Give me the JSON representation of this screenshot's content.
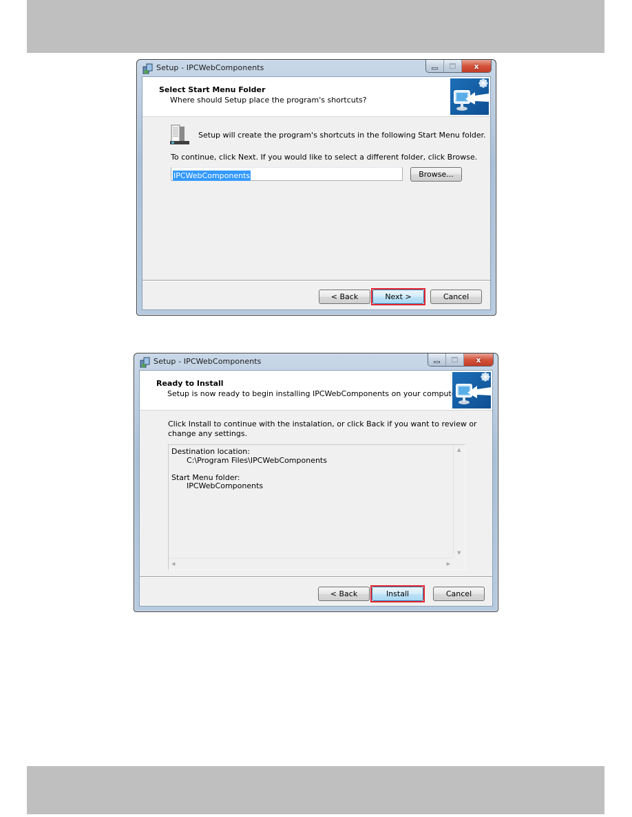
{
  "document": {
    "header_band": "",
    "footer_band": ""
  },
  "window1": {
    "title": "Setup - IPCWebComponents",
    "caption_buttons": {
      "minimize": "minimize",
      "maximize": "maximize",
      "close": "x"
    },
    "header": {
      "title": "Select Start Menu Folder",
      "subtitle": "Where should Setup place the program's shortcuts?",
      "image_icon": "monitor-arrow-icon"
    },
    "body": {
      "icon": "start-menu-folder-icon",
      "info_text": "Setup will create the program's shortcuts in the following Start Menu folder.",
      "instruction_text": "To continue, click Next. If you would like to select a different folder, click Browse.",
      "folder_input_value": "IPCWebComponents",
      "browse_label": "Browse..."
    },
    "footer": {
      "back_label": "< Back",
      "next_label": "Next >",
      "cancel_label": "Cancel",
      "highlighted_button": "Next >"
    }
  },
  "window2": {
    "title": "Setup - IPCWebComponents",
    "caption_buttons": {
      "minimize": "minimize",
      "maximize": "maximize",
      "close": "x"
    },
    "header": {
      "title": "Ready to Install",
      "subtitle": "Setup is now ready to begin installing IPCWebComponents on your computer.",
      "image_icon": "monitor-arrow-icon"
    },
    "body": {
      "instruction_line1": "Click Install to continue with the instalation, or click Back if you want to review or",
      "instruction_line2": "change any settings.",
      "summary": {
        "destination_label": "Destination location:",
        "destination_value": "C:\\Program Files\\IPCWebComponents",
        "start_menu_label": "Start Menu folder:",
        "start_menu_value": "IPCWebComponents"
      }
    },
    "footer": {
      "back_label": "< Back",
      "install_label": "Install",
      "cancel_label": "Cancel",
      "highlighted_button": "Install"
    }
  },
  "colors": {
    "highlight_red": "#e3232e",
    "selection_blue": "#3399ff",
    "band_gray": "#bfbfbf"
  }
}
